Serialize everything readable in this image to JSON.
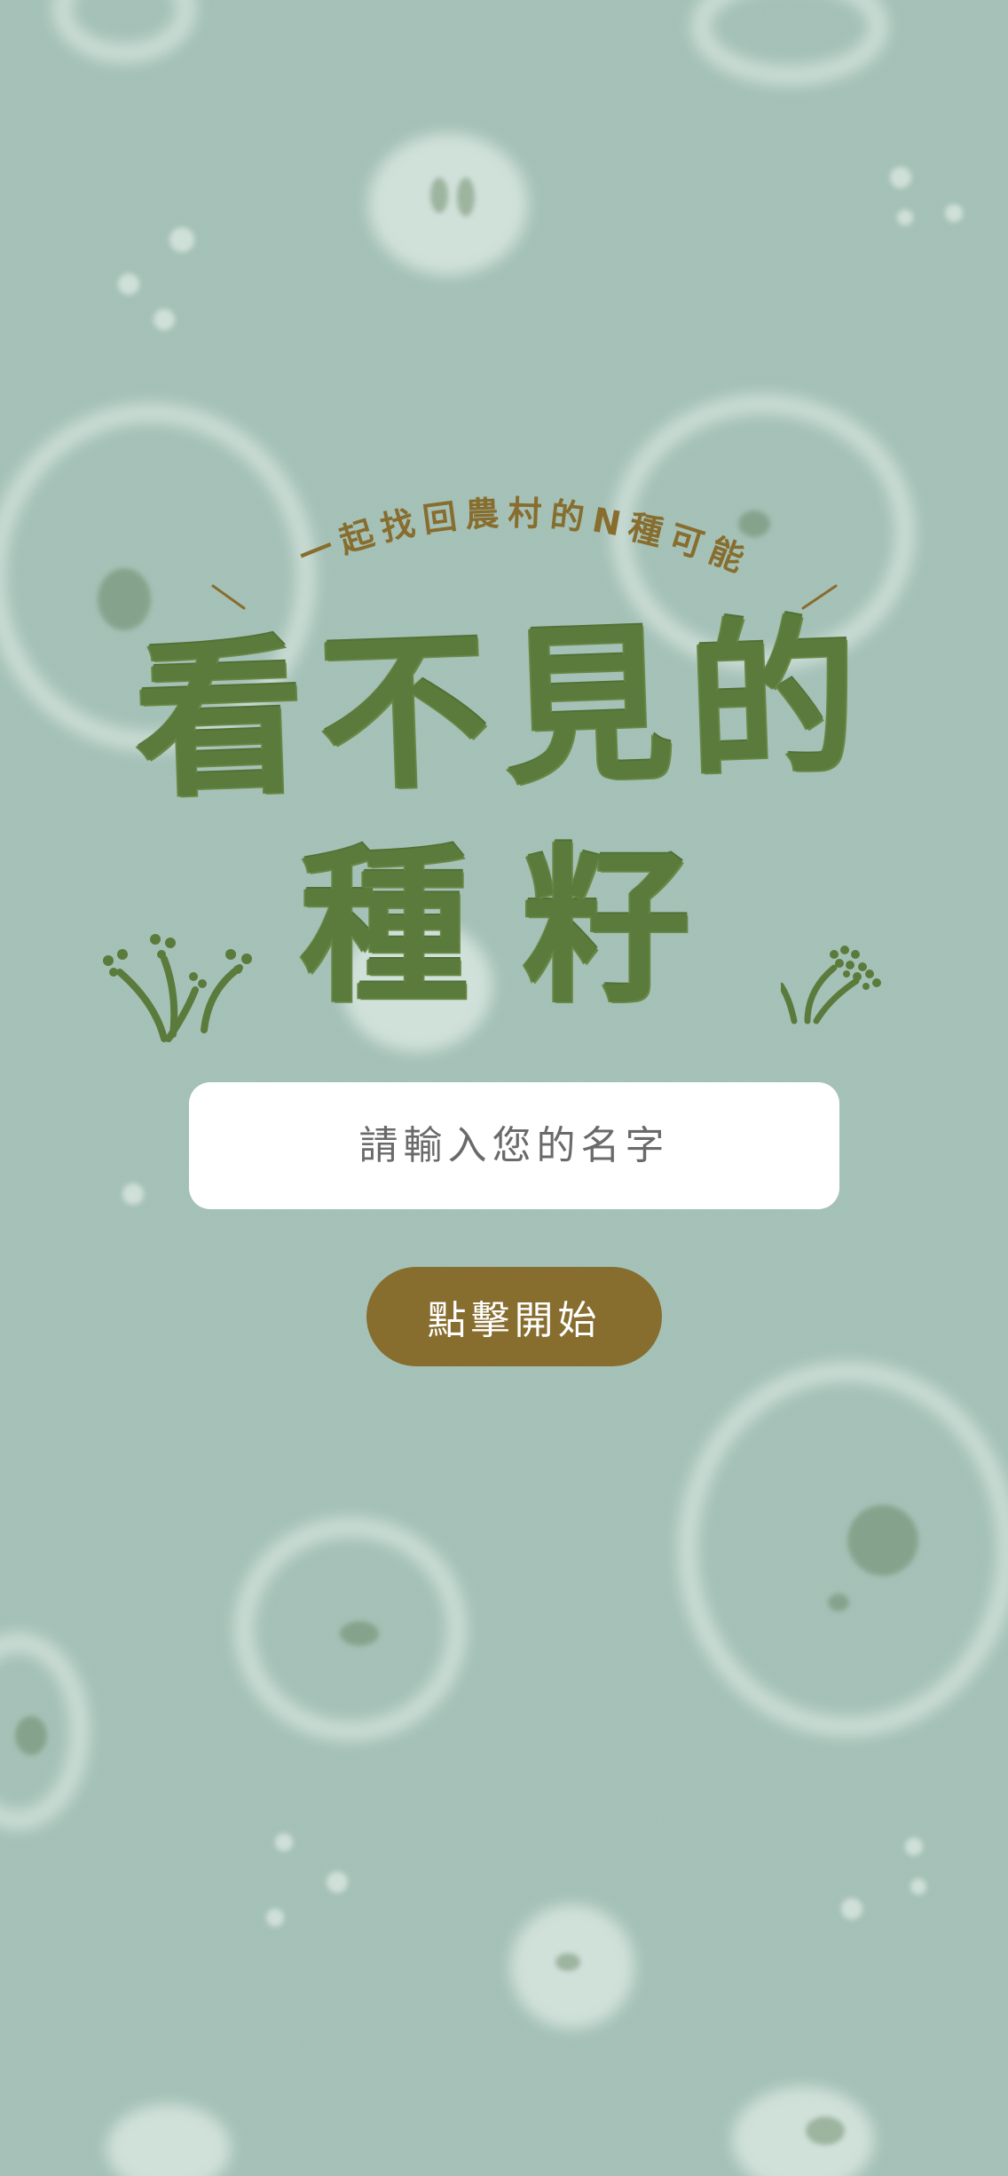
{
  "header": {
    "tagline": "一起找回農村的N種可能",
    "title_line_1": "看不見的",
    "title_line_2": "種籽"
  },
  "form": {
    "name_placeholder": "請輸入您的名字",
    "name_value": "",
    "start_label": "點擊開始"
  },
  "icons": {
    "left_decoration": "sprout-icon",
    "right_decoration": "sprout-icon"
  },
  "colors": {
    "background": "#9dbdb6",
    "title_green": "#5b7b3c",
    "tagline_brown": "#876d2e",
    "button_brown": "#876d2e",
    "input_background": "#ffffff"
  }
}
